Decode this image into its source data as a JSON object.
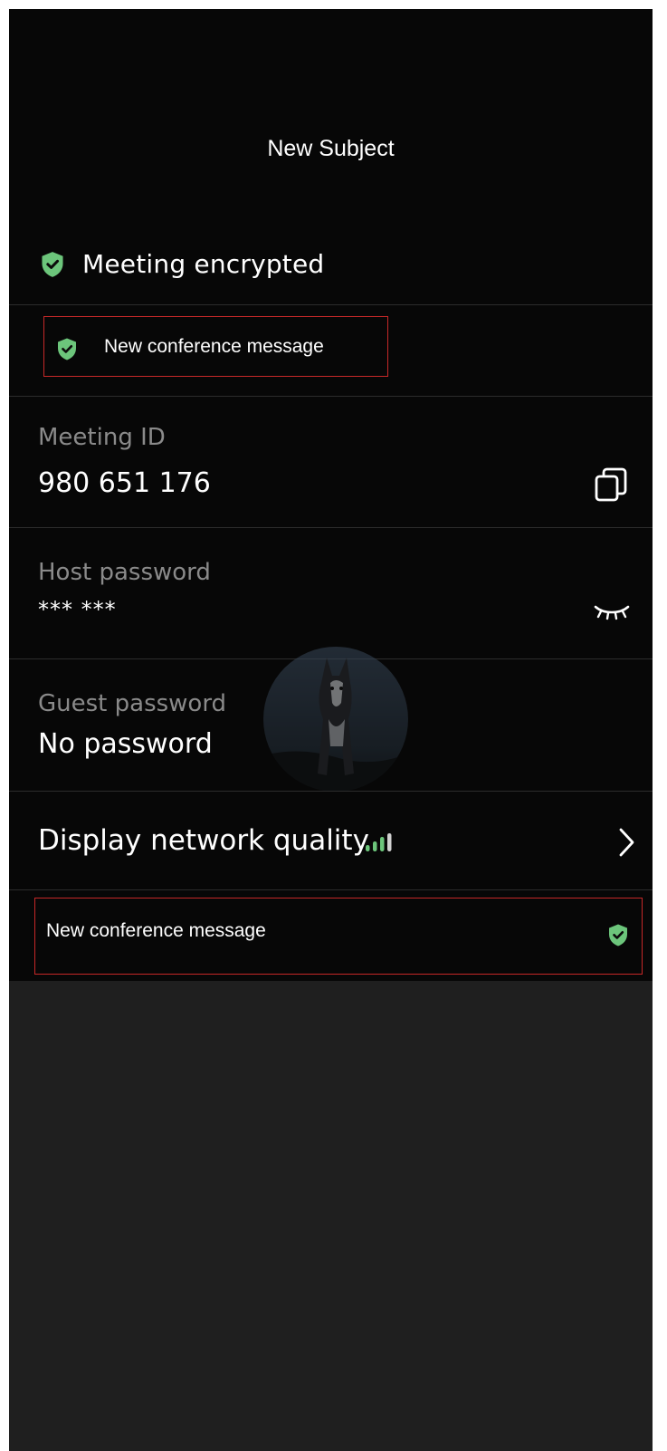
{
  "header": {
    "title": "New Subject"
  },
  "encryption": {
    "label": "Meeting encrypted",
    "icon": "shield-check-icon",
    "icon_color": "#6cc57b"
  },
  "notification_top": {
    "text": "New conference message",
    "icon": "shield-check-icon"
  },
  "meeting_id": {
    "label": "Meeting ID",
    "value": "980 651 176",
    "action_icon": "copy-icon"
  },
  "host_password": {
    "label": "Host password",
    "value": "*** ***",
    "action_icon": "eye-closed-icon"
  },
  "guest_password": {
    "label": "Guest password",
    "value": "No password"
  },
  "network_quality": {
    "label": "Display network quality",
    "icon": "signal-bars-icon",
    "action_icon": "chevron-right-icon",
    "signal_level": 0.75
  },
  "notification_bottom": {
    "text": "New conference message",
    "icon": "shield-check-icon"
  },
  "colors": {
    "background": "#070707",
    "lower_background": "#1f1f1f",
    "accent_green": "#6cc57b",
    "label_gray": "#8a8a8a",
    "highlight_border": "#c62828"
  }
}
